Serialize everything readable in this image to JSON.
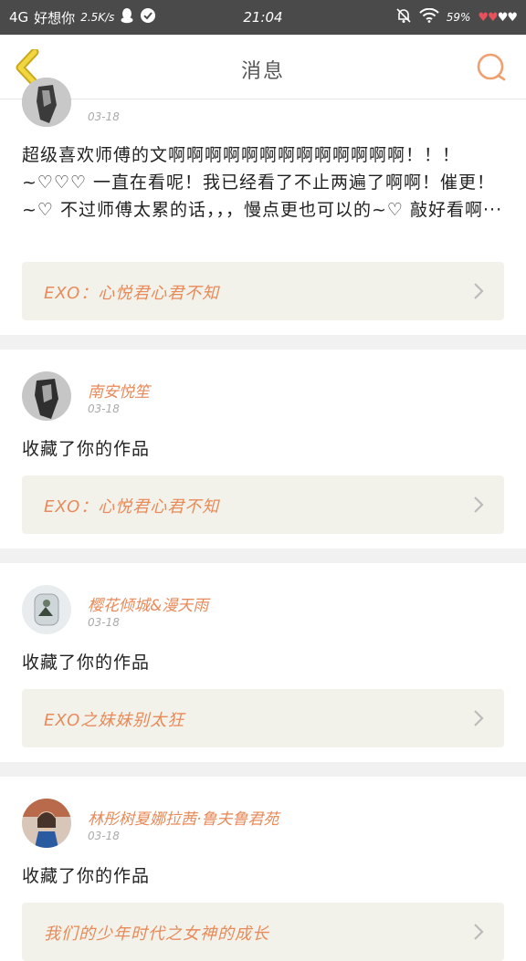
{
  "status_bar": {
    "network": "4G",
    "carrier": "好想你",
    "speed": "2.5K/s",
    "time": "21:04",
    "battery": "59%",
    "hearts_red": "♥♥",
    "hearts_white": "♥♥"
  },
  "header": {
    "title": "消息"
  },
  "items": [
    {
      "username": "",
      "date": "03-18",
      "message": "超级喜欢师傅的文啊啊啊啊啊啊啊啊啊啊啊啊啊！！！~♡♡♡ 一直在看呢！我已经看了不止两遍了啊啊！催更！~♡ 不过师傅太累的话，，，慢点更也可以的~♡ 敲好看啊···",
      "work": "EXO：心悦君心君不知"
    },
    {
      "username": "南安悦笙",
      "date": "03-18",
      "message": "收藏了你的作品",
      "work": "EXO：心悦君心君不知"
    },
    {
      "username": "樱花倾城&漫天雨",
      "date": "03-18",
      "message": "收藏了你的作品",
      "work": "EXO之妹妹别太狂"
    },
    {
      "username": "林彤树夏娜拉茜·鲁夫鲁君苑",
      "date": "03-18",
      "message": "收藏了你的作品",
      "work": "我们的少年时代之女神的成长"
    }
  ]
}
